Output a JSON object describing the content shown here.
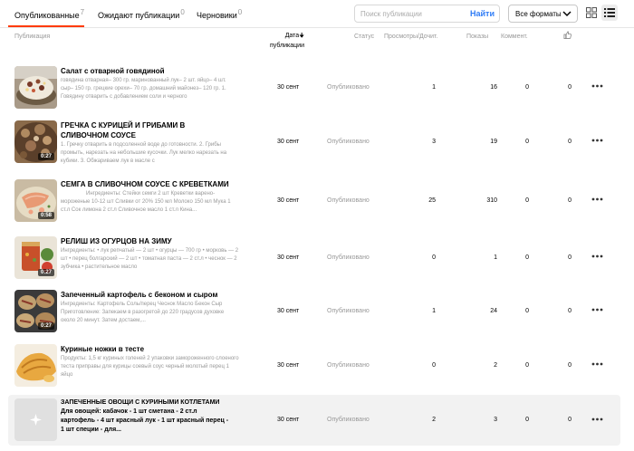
{
  "tabs": [
    {
      "label": "Опубликованные",
      "count": "7"
    },
    {
      "label": "Ожидают публикации",
      "count": "0"
    },
    {
      "label": "Черновики",
      "count": "0"
    }
  ],
  "search": {
    "placeholder": "Поиск публикации",
    "button": "Найти"
  },
  "formats": {
    "label": "Все форматы"
  },
  "columns": {
    "publication": "Публикация",
    "date_line1": "Дата",
    "date_line2": "публикации",
    "status": "Статус",
    "views": "Просмотры/Дочит.",
    "impressions": "Показы",
    "comments": "Коммент."
  },
  "colors": {
    "accent": "#ff3b00",
    "link": "#2f7cf6"
  },
  "icons": {
    "likes_header": "thumbs-up-icon",
    "sort": "arrow-down-icon",
    "row_menu": "more-dots-icon"
  },
  "rows": [
    {
      "title": "Салат с отварной говядиной",
      "desc": "говядина отварная– 300 гр. маринованный лук– 2 шт. яйцо– 4 шт. сыр– 150 гр. грецкие орехи– 70 гр. домашний майонез– 120 гр. 1. Говядину отварить с добавлением соли и черного",
      "duration": "",
      "date": "30 сент",
      "status": "Опубликовано",
      "views": "1",
      "impressions": "16",
      "comments": "0",
      "likes": "0"
    },
    {
      "title": "ГРЕЧКА С КУРИЦЕЙ И ГРИБАМИ В СЛИВОЧНОМ СОУСЕ",
      "desc": "1. Гречку отварить в подсоленной воде до готовности. 2. Грибы промыть, нарезать на небольшие кусочки. Лук мелко нарезать на кубики. 3. Обжариваем лук в масле с",
      "duration": "0:27",
      "date": "30 сент",
      "status": "Опубликовано",
      "views": "3",
      "impressions": "19",
      "comments": "0",
      "likes": "0"
    },
    {
      "title": "СЕМГА В СЛИВОЧНОМ СОУСЕ С КРЕВЕТКАМИ",
      "desc": "Ингредиенты: Стейки семги 2 шт Креветки варено-мороженые 10-12 шт Сливки от 20% 150 мл Молоко 150 мл Мука 1 ст.л Сок лимона 2 ст.л Сливочное масло 1 ст.л Кина...",
      "duration": "0:58",
      "date": "30 сент",
      "status": "Опубликовано",
      "views": "25",
      "impressions": "310",
      "comments": "0",
      "likes": "0"
    },
    {
      "title": "РЕЛИШ ИЗ ОГУРЦОВ НА ЗИМУ",
      "desc": "Ингредиенты: • лук репчатый — 2 шт • огурцы — 700 гр • морковь — 2 шт • перец болгарский — 2 шт • томатная паста — 2 ст.л • чеснок — 2 зубчика • растительное масло",
      "duration": "0:27",
      "date": "30 сент",
      "status": "Опубликовано",
      "views": "0",
      "impressions": "1",
      "comments": "0",
      "likes": "0"
    },
    {
      "title": "Запеченный картофель с беконом и сыром",
      "desc": "Ингредиенты: Картофель Соль/перец Чеснок Масло Бекон Сыр Приготовление: Запекаем в разогретой до 220 градусов духовке около 20 минут. Затем достаем,...",
      "duration": "0:27",
      "date": "30 сент",
      "status": "Опубликовано",
      "views": "1",
      "impressions": "24",
      "comments": "0",
      "likes": "0"
    },
    {
      "title": "Куриные ножки в тесте",
      "desc": "Продукты: 1,5 кг куриных голеней 2 упаковки замороженного слоеного теста приправы для курицы соевый соус черный молотый перец 1 яйцо",
      "duration": "",
      "date": "30 сент",
      "status": "Опубликовано",
      "views": "0",
      "impressions": "2",
      "comments": "0",
      "likes": "0"
    },
    {
      "title": "ЗАПЕЧЕННЫЕ ОВОЩИ С КУРИНЫМИ КОТЛЕТАМИ Для овощей: кабачок - 1 шт сметана - 2 ст.л картофель - 4 шт красный лук - 1 шт красный перец - 1 шт специи - для...",
      "desc": "",
      "duration": "",
      "date": "30 сент",
      "status": "Опубликовано",
      "views": "2",
      "impressions": "3",
      "comments": "0",
      "likes": "0"
    }
  ]
}
